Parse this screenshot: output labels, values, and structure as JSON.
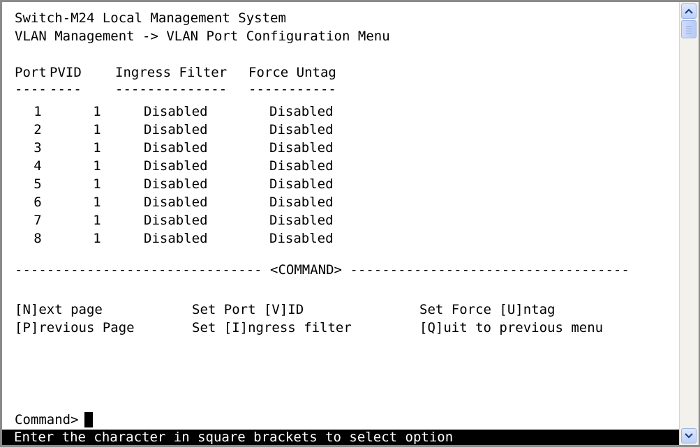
{
  "header": {
    "line1": "Switch-M24 Local Management System",
    "line2": "VLAN Management -> VLAN Port Configuration Menu"
  },
  "table": {
    "headers": [
      "Port",
      "PVID",
      "Ingress Filter",
      "Force Untag"
    ],
    "underlines": [
      "----",
      "----",
      "--------------",
      "-----------"
    ],
    "rows": [
      {
        "port": "1",
        "pvid": "1",
        "ingress": "Disabled",
        "untag": "Disabled"
      },
      {
        "port": "2",
        "pvid": "1",
        "ingress": "Disabled",
        "untag": "Disabled"
      },
      {
        "port": "3",
        "pvid": "1",
        "ingress": "Disabled",
        "untag": "Disabled"
      },
      {
        "port": "4",
        "pvid": "1",
        "ingress": "Disabled",
        "untag": "Disabled"
      },
      {
        "port": "5",
        "pvid": "1",
        "ingress": "Disabled",
        "untag": "Disabled"
      },
      {
        "port": "6",
        "pvid": "1",
        "ingress": "Disabled",
        "untag": "Disabled"
      },
      {
        "port": "7",
        "pvid": "1",
        "ingress": "Disabled",
        "untag": "Disabled"
      },
      {
        "port": "8",
        "pvid": "1",
        "ingress": "Disabled",
        "untag": "Disabled"
      }
    ]
  },
  "command_divider": "------------------------------- <COMMAND> -----------------------------------",
  "commands": {
    "next_page": "[N]ext page",
    "previous_page": "[P]revious Page",
    "set_port_vid": "Set Port [V]ID",
    "set_ingress": "Set [I]ngress filter",
    "set_force_untag": "Set Force [U]ntag",
    "quit": "[Q]uit to previous menu"
  },
  "prompt": "Command>",
  "status": "Enter the character in square brackets to select option",
  "icons": {
    "scroll_up": "chevron-up-icon",
    "scroll_down": "chevron-down-icon"
  }
}
